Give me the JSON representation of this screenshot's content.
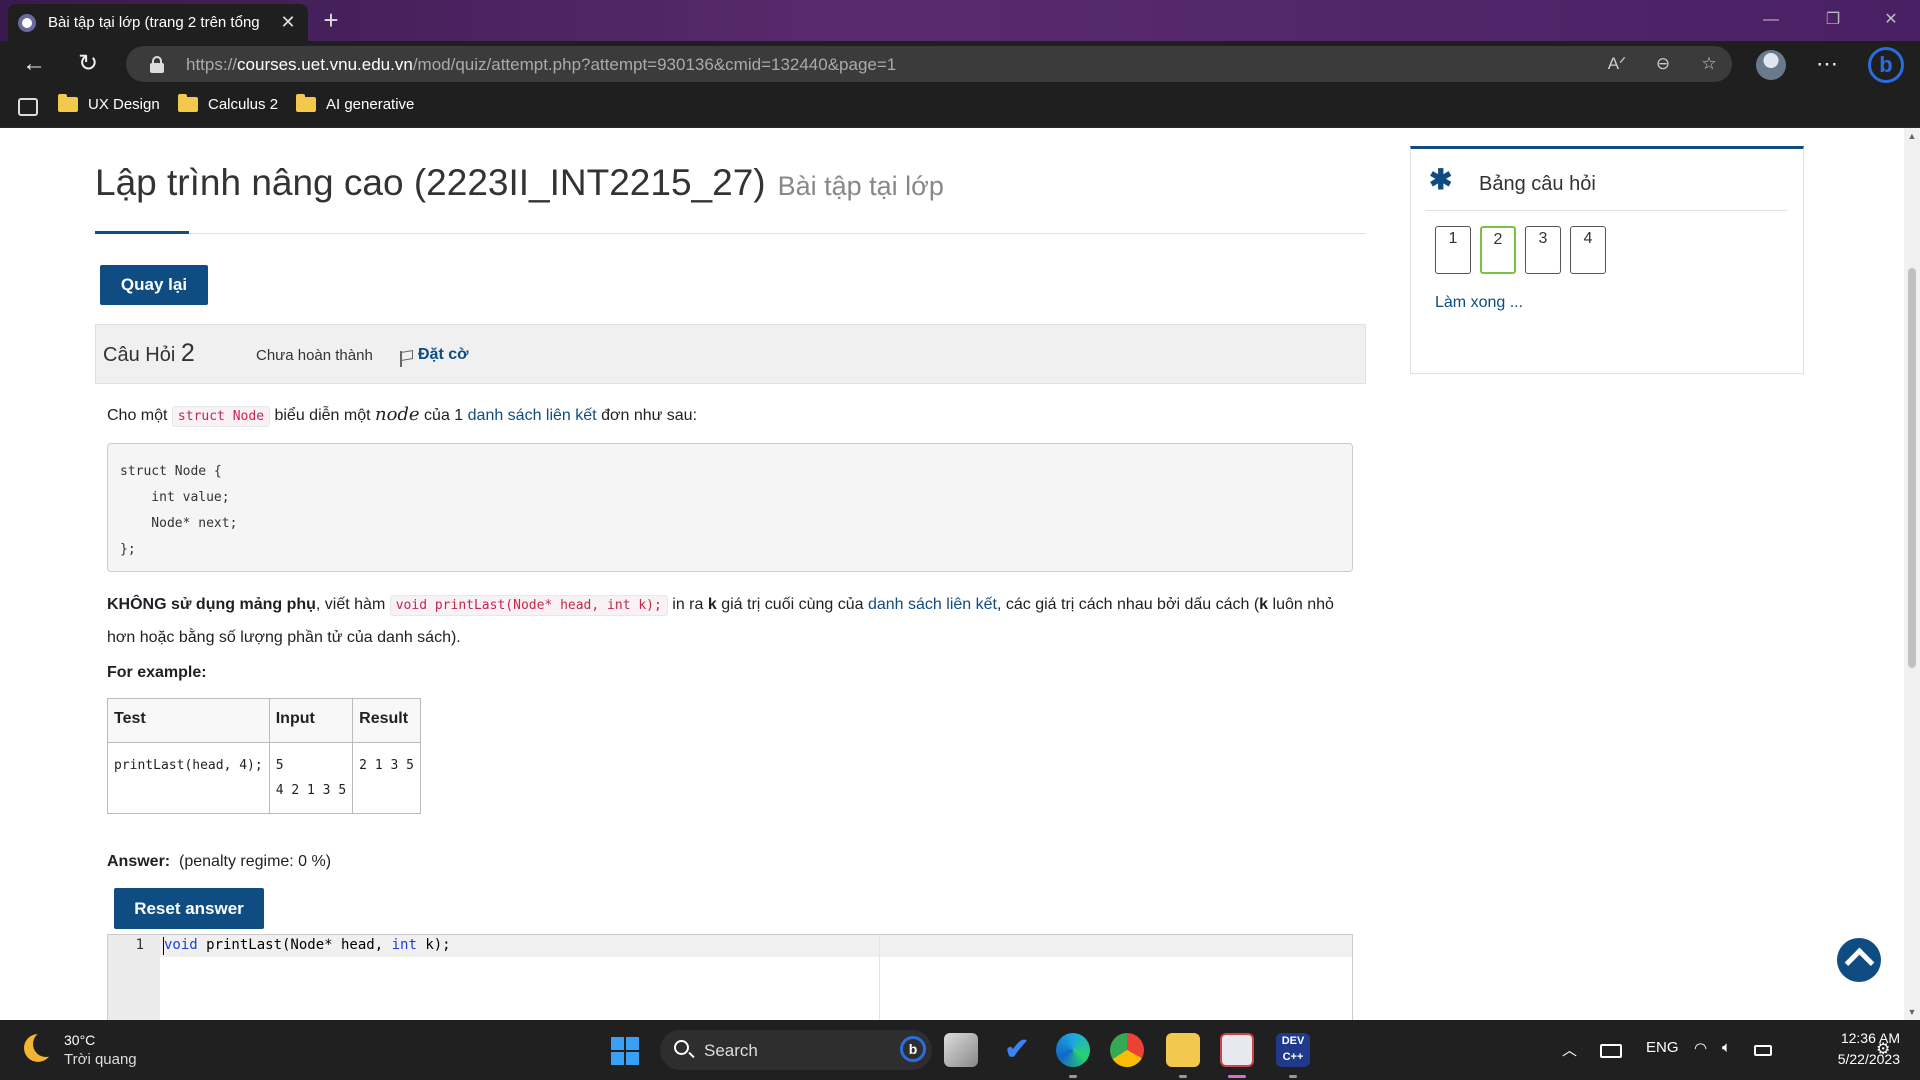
{
  "browser": {
    "tab_title": "Bài tập tại lớp (trang 2 trên tổng",
    "url_scheme": "https://",
    "url_host": "courses.uet.vnu.edu.vn",
    "url_path": "/mod/quiz/attempt.php?attempt=930136&cmid=132440&page=1",
    "bookmarks": [
      "UX Design",
      "Calculus 2",
      "AI generative"
    ]
  },
  "page": {
    "course_title": "Lập trình nâng cao (2223II_INT2215_27)",
    "course_subtitle": "Bài tập tại lớp",
    "back_button": "Quay lại"
  },
  "question": {
    "label": "Câu Hỏi",
    "number": "2",
    "state": "Chưa hoàn thành",
    "flag_label": "Đặt cờ",
    "intro": {
      "t1": "Cho một",
      "code1": "struct Node",
      "t2": "biểu diễn một",
      "math": "node",
      "t3": "của 1",
      "link": "danh sách liên kết",
      "t4": "đơn như sau:"
    },
    "code_block": "struct Node {\n    int value;\n    Node* next;\n};",
    "task": {
      "bold1": "KHÔNG sử dụng mảng phụ",
      "t1": ", viết hàm",
      "code": "void printLast(Node* head, int k);",
      "t2": "in ra",
      "bold2": "k",
      "t3": "giá trị cuối cùng của",
      "link": "danh sách liên kết",
      "t4": ", các giá trị cách nhau bởi dấu cách (",
      "bold3": "k",
      "t5": "luôn nhỏ hơn hoặc bằng số lượng phần tử của danh sách)."
    },
    "example_label": "For example:",
    "example_table": {
      "headers": [
        "Test",
        "Input",
        "Result"
      ],
      "rows": [
        [
          "printLast(head, 4);",
          "5\n4 2 1 3 5",
          "2 1 3 5"
        ]
      ]
    },
    "answer_label": "Answer:",
    "penalty": "(penalty regime: 0 %)",
    "reset_button": "Reset answer",
    "editor": {
      "line_number": "1",
      "kw1": "void",
      "mid": " printLast(Node* head, ",
      "kw2": "int",
      "end": " k);"
    }
  },
  "quiz_nav": {
    "title": "Bảng câu hỏi",
    "questions": [
      "1",
      "2",
      "3",
      "4"
    ],
    "current": "2",
    "finish": "Làm xong ..."
  },
  "taskbar": {
    "weather_temp": "30°C",
    "weather_desc": "Trời quang",
    "search_placeholder": "Search",
    "language": "ENG",
    "time": "12:36 AM",
    "date": "5/22/2023"
  },
  "colors": {
    "primary": "#0f4c81",
    "current_question_border": "#7bc143",
    "inline_code": "#c7254e"
  }
}
